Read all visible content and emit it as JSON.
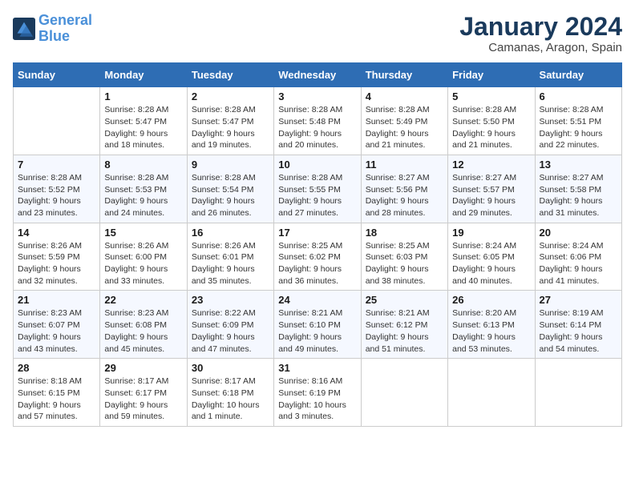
{
  "logo": {
    "line1": "General",
    "line2": "Blue"
  },
  "title": "January 2024",
  "location": "Camanas, Aragon, Spain",
  "weekdays": [
    "Sunday",
    "Monday",
    "Tuesday",
    "Wednesday",
    "Thursday",
    "Friday",
    "Saturday"
  ],
  "weeks": [
    [
      {
        "day": "",
        "info": ""
      },
      {
        "day": "1",
        "info": "Sunrise: 8:28 AM\nSunset: 5:47 PM\nDaylight: 9 hours\nand 18 minutes."
      },
      {
        "day": "2",
        "info": "Sunrise: 8:28 AM\nSunset: 5:47 PM\nDaylight: 9 hours\nand 19 minutes."
      },
      {
        "day": "3",
        "info": "Sunrise: 8:28 AM\nSunset: 5:48 PM\nDaylight: 9 hours\nand 20 minutes."
      },
      {
        "day": "4",
        "info": "Sunrise: 8:28 AM\nSunset: 5:49 PM\nDaylight: 9 hours\nand 21 minutes."
      },
      {
        "day": "5",
        "info": "Sunrise: 8:28 AM\nSunset: 5:50 PM\nDaylight: 9 hours\nand 21 minutes."
      },
      {
        "day": "6",
        "info": "Sunrise: 8:28 AM\nSunset: 5:51 PM\nDaylight: 9 hours\nand 22 minutes."
      }
    ],
    [
      {
        "day": "7",
        "info": "Sunrise: 8:28 AM\nSunset: 5:52 PM\nDaylight: 9 hours\nand 23 minutes."
      },
      {
        "day": "8",
        "info": "Sunrise: 8:28 AM\nSunset: 5:53 PM\nDaylight: 9 hours\nand 24 minutes."
      },
      {
        "day": "9",
        "info": "Sunrise: 8:28 AM\nSunset: 5:54 PM\nDaylight: 9 hours\nand 26 minutes."
      },
      {
        "day": "10",
        "info": "Sunrise: 8:28 AM\nSunset: 5:55 PM\nDaylight: 9 hours\nand 27 minutes."
      },
      {
        "day": "11",
        "info": "Sunrise: 8:27 AM\nSunset: 5:56 PM\nDaylight: 9 hours\nand 28 minutes."
      },
      {
        "day": "12",
        "info": "Sunrise: 8:27 AM\nSunset: 5:57 PM\nDaylight: 9 hours\nand 29 minutes."
      },
      {
        "day": "13",
        "info": "Sunrise: 8:27 AM\nSunset: 5:58 PM\nDaylight: 9 hours\nand 31 minutes."
      }
    ],
    [
      {
        "day": "14",
        "info": "Sunrise: 8:26 AM\nSunset: 5:59 PM\nDaylight: 9 hours\nand 32 minutes."
      },
      {
        "day": "15",
        "info": "Sunrise: 8:26 AM\nSunset: 6:00 PM\nDaylight: 9 hours\nand 33 minutes."
      },
      {
        "day": "16",
        "info": "Sunrise: 8:26 AM\nSunset: 6:01 PM\nDaylight: 9 hours\nand 35 minutes."
      },
      {
        "day": "17",
        "info": "Sunrise: 8:25 AM\nSunset: 6:02 PM\nDaylight: 9 hours\nand 36 minutes."
      },
      {
        "day": "18",
        "info": "Sunrise: 8:25 AM\nSunset: 6:03 PM\nDaylight: 9 hours\nand 38 minutes."
      },
      {
        "day": "19",
        "info": "Sunrise: 8:24 AM\nSunset: 6:05 PM\nDaylight: 9 hours\nand 40 minutes."
      },
      {
        "day": "20",
        "info": "Sunrise: 8:24 AM\nSunset: 6:06 PM\nDaylight: 9 hours\nand 41 minutes."
      }
    ],
    [
      {
        "day": "21",
        "info": "Sunrise: 8:23 AM\nSunset: 6:07 PM\nDaylight: 9 hours\nand 43 minutes."
      },
      {
        "day": "22",
        "info": "Sunrise: 8:23 AM\nSunset: 6:08 PM\nDaylight: 9 hours\nand 45 minutes."
      },
      {
        "day": "23",
        "info": "Sunrise: 8:22 AM\nSunset: 6:09 PM\nDaylight: 9 hours\nand 47 minutes."
      },
      {
        "day": "24",
        "info": "Sunrise: 8:21 AM\nSunset: 6:10 PM\nDaylight: 9 hours\nand 49 minutes."
      },
      {
        "day": "25",
        "info": "Sunrise: 8:21 AM\nSunset: 6:12 PM\nDaylight: 9 hours\nand 51 minutes."
      },
      {
        "day": "26",
        "info": "Sunrise: 8:20 AM\nSunset: 6:13 PM\nDaylight: 9 hours\nand 53 minutes."
      },
      {
        "day": "27",
        "info": "Sunrise: 8:19 AM\nSunset: 6:14 PM\nDaylight: 9 hours\nand 54 minutes."
      }
    ],
    [
      {
        "day": "28",
        "info": "Sunrise: 8:18 AM\nSunset: 6:15 PM\nDaylight: 9 hours\nand 57 minutes."
      },
      {
        "day": "29",
        "info": "Sunrise: 8:17 AM\nSunset: 6:17 PM\nDaylight: 9 hours\nand 59 minutes."
      },
      {
        "day": "30",
        "info": "Sunrise: 8:17 AM\nSunset: 6:18 PM\nDaylight: 10 hours\nand 1 minute."
      },
      {
        "day": "31",
        "info": "Sunrise: 8:16 AM\nSunset: 6:19 PM\nDaylight: 10 hours\nand 3 minutes."
      },
      {
        "day": "",
        "info": ""
      },
      {
        "day": "",
        "info": ""
      },
      {
        "day": "",
        "info": ""
      }
    ]
  ]
}
